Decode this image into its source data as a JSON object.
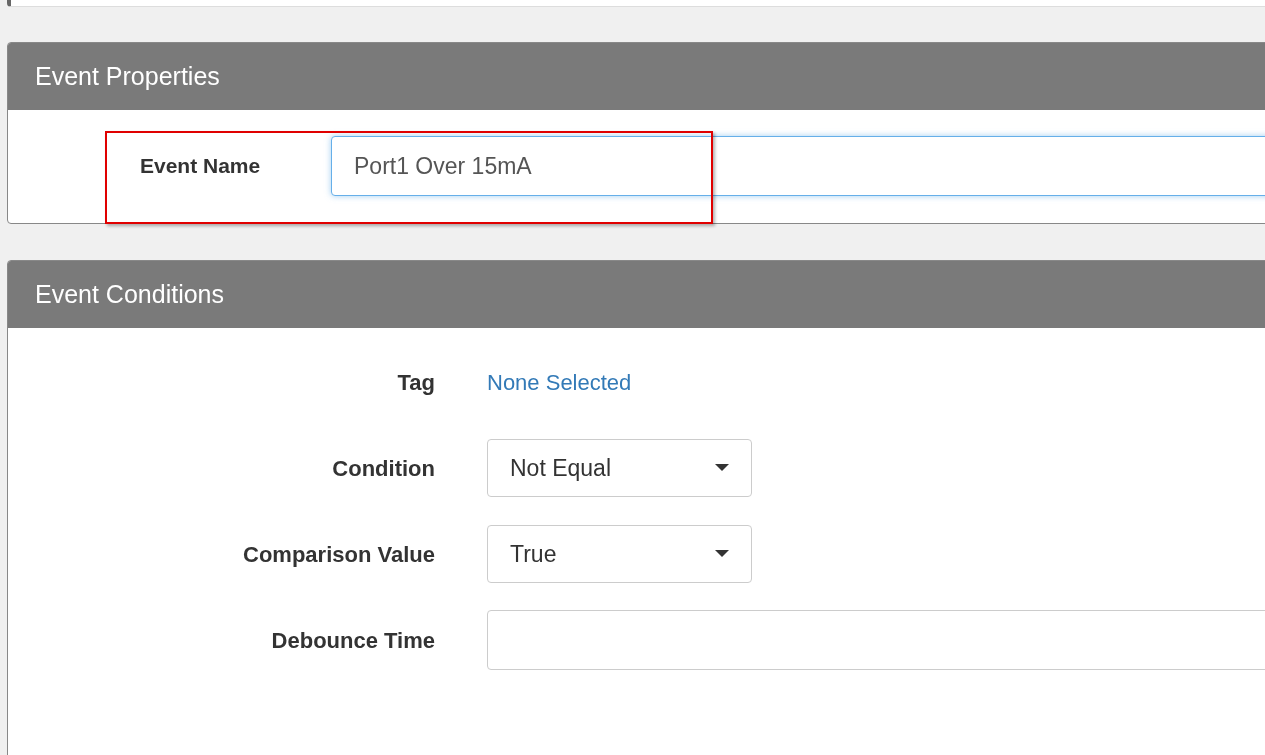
{
  "event_properties": {
    "title": "Event Properties",
    "fields": [
      {
        "label": "Event Name",
        "value": "Port1 Over 15mA",
        "focused": true
      }
    ]
  },
  "event_conditions": {
    "title": "Event Conditions",
    "fields": [
      {
        "kind": "link",
        "label": "Tag",
        "value": "None Selected"
      },
      {
        "kind": "select",
        "label": "Condition",
        "value": "Not Equal"
      },
      {
        "kind": "select",
        "label": "Comparison Value",
        "value": "True"
      },
      {
        "kind": "input",
        "label": "Debounce Time"
      }
    ]
  }
}
